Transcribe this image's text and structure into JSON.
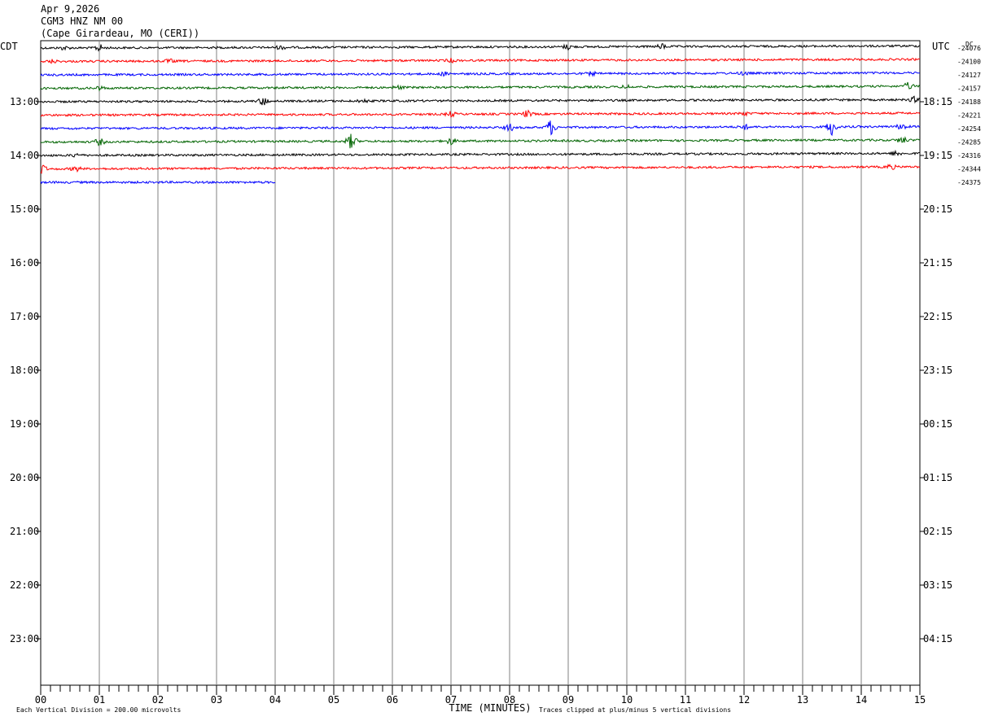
{
  "header": {
    "date": "Apr 9,2026",
    "station": "CGM3 HNZ NM 00",
    "location": "(Cape Girardeau, MO (CERI))"
  },
  "chart_data": {
    "type": "line",
    "title": "CGM3 HNZ NM 00",
    "left_axis_title": "CDT",
    "right_axis_title": "UTC",
    "dc_label": "DC",
    "xlabel": "TIME (MINUTES)",
    "xlim": [
      0,
      15
    ],
    "x_tick_labels": [
      "00",
      "01",
      "02",
      "03",
      "04",
      "05",
      "06",
      "07",
      "08",
      "09",
      "10",
      "11",
      "12",
      "13",
      "14",
      "15"
    ],
    "hour_labels_left": [
      "13:00",
      "14:00",
      "15:00",
      "16:00",
      "17:00",
      "18:00",
      "19:00",
      "20:00",
      "21:00",
      "22:00",
      "23:00"
    ],
    "hour_labels_right": [
      "18:15",
      "19:15",
      "20:15",
      "21:15",
      "22:15",
      "23:15",
      "00:15",
      "01:15",
      "02:15",
      "03:15",
      "04:15"
    ],
    "first_hour_label_row": 4,
    "rows_per_hour": 4,
    "total_rows": 48,
    "trace_colors": [
      "#000000",
      "#ff0000",
      "#0000ff",
      "#006400"
    ],
    "traces": [
      {
        "row": 0,
        "color": "#000000",
        "dc_offset": "-24076",
        "minutes_recorded": 15,
        "activity": [
          [
            0.4,
            2
          ],
          [
            1.0,
            4
          ],
          [
            4.1,
            2
          ],
          [
            9.0,
            3
          ],
          [
            10.6,
            3
          ]
        ]
      },
      {
        "row": 1,
        "color": "#ff0000",
        "dc_offset": "-24100",
        "minutes_recorded": 15,
        "activity": [
          [
            0.2,
            2
          ],
          [
            2.2,
            2
          ],
          [
            7.0,
            2
          ]
        ]
      },
      {
        "row": 2,
        "color": "#0000ff",
        "dc_offset": "-24127",
        "minutes_recorded": 15,
        "activity": [
          [
            6.9,
            2
          ],
          [
            9.4,
            2
          ],
          [
            12.0,
            2
          ]
        ]
      },
      {
        "row": 3,
        "color": "#006400",
        "dc_offset": "-24157",
        "minutes_recorded": 15,
        "activity": [
          [
            1.0,
            2
          ],
          [
            6.1,
            2
          ],
          [
            10.0,
            2
          ],
          [
            14.8,
            4
          ]
        ]
      },
      {
        "row": 4,
        "color": "#000000",
        "dc_offset": "-24188",
        "minutes_recorded": 15,
        "activity": [
          [
            3.8,
            5
          ],
          [
            5.5,
            2
          ],
          [
            14.9,
            3
          ]
        ]
      },
      {
        "row": 5,
        "color": "#ff0000",
        "dc_offset": "-24221",
        "minutes_recorded": 15,
        "activity": [
          [
            7.0,
            3
          ],
          [
            8.3,
            4
          ],
          [
            12.0,
            2
          ]
        ]
      },
      {
        "row": 6,
        "color": "#0000ff",
        "dc_offset": "-24254",
        "minutes_recorded": 15,
        "activity": [
          [
            8.7,
            9
          ],
          [
            8.0,
            4
          ],
          [
            12.0,
            3
          ],
          [
            13.5,
            10
          ],
          [
            14.7,
            4
          ]
        ]
      },
      {
        "row": 7,
        "color": "#006400",
        "dc_offset": "-24285",
        "minutes_recorded": 15,
        "activity": [
          [
            1.0,
            4
          ],
          [
            5.3,
            9
          ],
          [
            7.0,
            4
          ],
          [
            14.7,
            4
          ]
        ]
      },
      {
        "row": 8,
        "color": "#000000",
        "dc_offset": "-24316",
        "minutes_recorded": 15,
        "activity": [
          [
            0.6,
            2
          ],
          [
            14.6,
            3
          ]
        ]
      },
      {
        "row": 9,
        "color": "#ff0000",
        "dc_offset": "-24344",
        "minutes_recorded": 15,
        "activity": [
          [
            0.0,
            8
          ],
          [
            0.6,
            3
          ],
          [
            14.5,
            3
          ]
        ]
      },
      {
        "row": 10,
        "color": "#0000ff",
        "dc_offset": "-24375",
        "minutes_recorded": 4,
        "activity": []
      }
    ],
    "vertical_division": "Each Vertical Division =  200.00 microvolts",
    "clip_note": "Traces clipped at plus/minus 5 vertical divisions",
    "grid": true
  }
}
